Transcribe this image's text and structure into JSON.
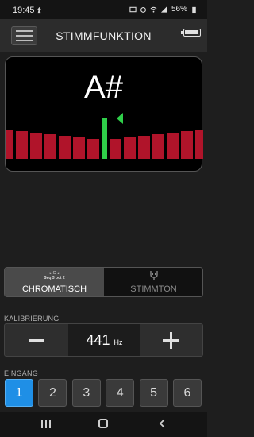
{
  "status_bar": {
    "time": "19:45",
    "battery_percent": "56%",
    "icons": [
      "notification-icon",
      "image-icon",
      "alarm-icon",
      "wifi-icon",
      "signal-icon",
      "battery-icon"
    ]
  },
  "header": {
    "title": "STIMMFUNKTION",
    "menu_icon": "hamburger-menu-icon",
    "battery_icon": "battery-icon"
  },
  "tuner": {
    "note": "A#",
    "meter": {
      "segments_per_side": 7,
      "center_color": "#2fcf4a",
      "segment_color": "#b0142a",
      "arrow_color": "#2fcf4a",
      "arrow_direction": "left"
    }
  },
  "mode": {
    "chromatic_icon_text": "• C •\nSeq 3 oct 2",
    "options": [
      {
        "label": "CHROMATISCH",
        "active": true
      },
      {
        "label": "STIMMTON",
        "active": false
      }
    ]
  },
  "calibration": {
    "label": "KALIBRIERUNG",
    "value": "441",
    "unit": "Hz"
  },
  "input": {
    "label": "EINGANG",
    "options": [
      "1",
      "2",
      "3",
      "4",
      "5",
      "6"
    ],
    "selected": "1",
    "selected_color": "#1f8fe6"
  },
  "nav": {
    "icons": [
      "recents-icon",
      "home-icon",
      "back-icon"
    ]
  }
}
